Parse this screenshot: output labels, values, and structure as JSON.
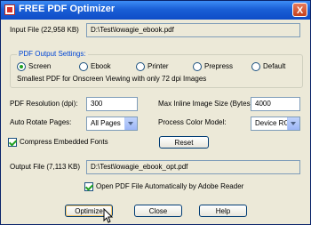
{
  "window": {
    "title": "FREE PDF Optimizer",
    "close_label": "X"
  },
  "input_file": {
    "label": "Input File (22,958 KB)",
    "value": "D:\\Test\\lowagie_ebook.pdf"
  },
  "output_settings": {
    "legend": "PDF Output Settings:",
    "options": [
      "Screen",
      "Ebook",
      "Printer",
      "Prepress",
      "Default"
    ],
    "selected": "Screen",
    "description": "Smallest PDF for Onscreen Viewing with only 72 dpi Images"
  },
  "resolution": {
    "label": "PDF Resolution (dpi):",
    "value": "300"
  },
  "inline_image": {
    "label": "Max Inline Image Size (Bytes):",
    "value": "4000"
  },
  "auto_rotate": {
    "label": "Auto Rotate Pages:",
    "value": "All Pages"
  },
  "color_model": {
    "label": "Process Color Model:",
    "value": "Device RGB"
  },
  "compress_fonts": {
    "label": "Compress Embedded Fonts",
    "checked": true
  },
  "reset_button": "Reset",
  "output_file": {
    "label": "Output File (7,113 KB)",
    "value": "D:\\Test\\lowagie_ebook_opt.pdf"
  },
  "open_pdf": {
    "label": "Open PDF File Automatically by Adobe Reader",
    "checked": true
  },
  "buttons": {
    "optimize": "Optimize",
    "close": "Close",
    "help": "Help"
  }
}
